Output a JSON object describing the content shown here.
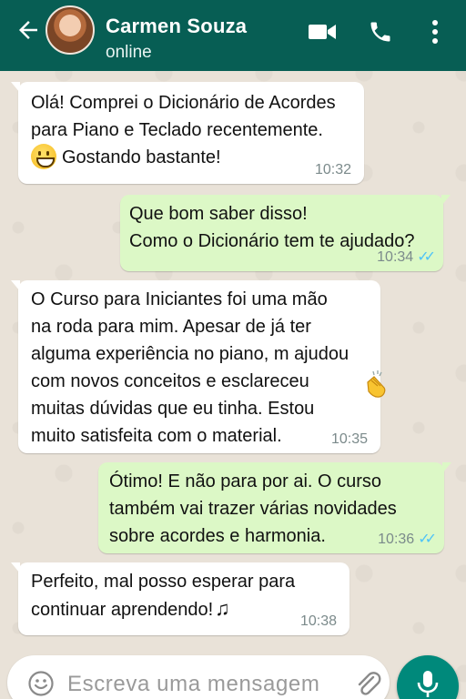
{
  "colors": {
    "header": "#075e54",
    "incoming_bubble": "#ffffff",
    "outgoing_bubble": "#dcf8c6",
    "chat_background": "#e9e2d8",
    "read_ticks": "#4fc3f7",
    "mic_button": "#00897b"
  },
  "header": {
    "contact_name": "Carmen Souza",
    "status": "online",
    "icons": [
      "back-arrow-icon",
      "avatar",
      "video-call-icon",
      "phone-icon",
      "more-vert-icon"
    ]
  },
  "messages": [
    {
      "direction": "incoming",
      "lines": [
        "Olá! Comprei o Dicionário de Acordes",
        "para Piano e Teclado recentemente."
      ],
      "emoji": "grinning-face",
      "last_line": "Gostando bastante!",
      "time": "10:32"
    },
    {
      "direction": "outgoing",
      "lines": [
        "Que bom saber disso!",
        "Como o Dicionário tem te ajudado?"
      ],
      "time": "10:34",
      "ticks": "✓✓"
    },
    {
      "direction": "incoming",
      "lines": [
        "O Curso para Iniciantes foi uma mão",
        "na roda para mim. Apesar de já ter",
        "alguma experiência no piano, m ajudou",
        "com novos conceitos e esclareceu",
        "muitas dúvidas que eu tinha. Estou",
        "muito satisfeita com o material."
      ],
      "emoji": "clapping-hands",
      "time": "10:35"
    },
    {
      "direction": "outgoing",
      "lines": [
        "Ótimo! E não para por ai. O curso",
        "também vai trazer várias novidades",
        "sobre acordes e harmonia."
      ],
      "time": "10:36",
      "ticks": "✓✓"
    },
    {
      "direction": "incoming",
      "lines": [
        "Perfeito, mal posso esperar para",
        "continuar aprendendo!"
      ],
      "emoji_text": "♫",
      "time": "10:38"
    }
  ],
  "composer": {
    "placeholder": "Escreva uma mensagem",
    "icons": [
      "emoji-smiley-icon",
      "attach-paperclip-icon",
      "microphone-icon"
    ]
  }
}
